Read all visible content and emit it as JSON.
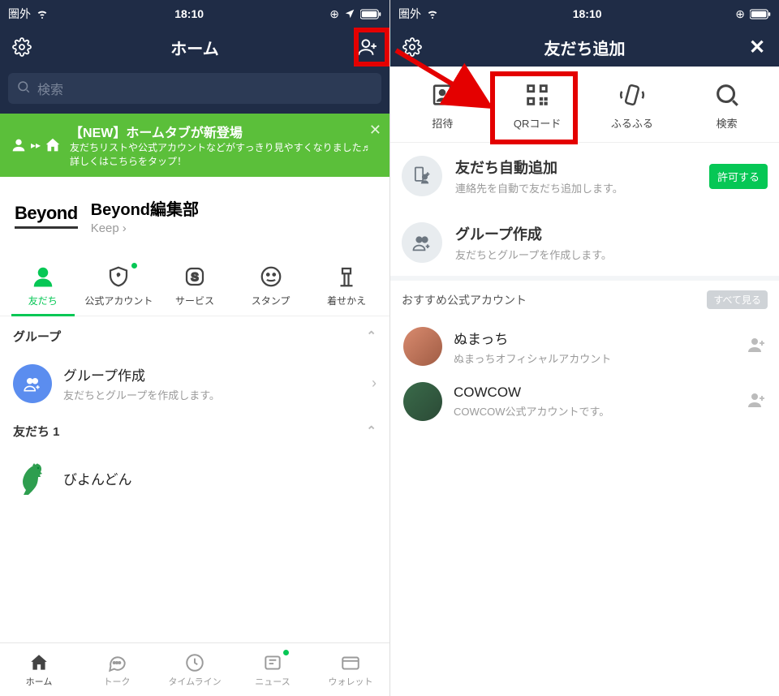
{
  "status": {
    "carrier": "圏外",
    "time": "18:10"
  },
  "left": {
    "title": "ホーム",
    "search_placeholder": "検索",
    "banner": {
      "title": "【NEW】ホームタブが新登場",
      "sub": "友だちリストや公式アカウントなどがすっきり見やすくなりました♬詳しくはこちらをタップ！"
    },
    "profile": {
      "logo": "Beyond",
      "name": "Beyond編集部",
      "keep": "Keep"
    },
    "tabs": {
      "friends": "友だち",
      "official": "公式アカウント",
      "service": "サービス",
      "stamp": "スタンプ",
      "theme": "着せかえ"
    },
    "section_groups": "グループ",
    "group_create": {
      "title": "グループ作成",
      "sub": "友だちとグループを作成します。"
    },
    "section_friends": "友だち 1",
    "friend1": "びよんどん",
    "bottom": {
      "home": "ホーム",
      "talk": "トーク",
      "timeline": "タイムライン",
      "news": "ニュース",
      "wallet": "ウォレット"
    }
  },
  "right": {
    "title": "友だち追加",
    "add": {
      "invite": "招待",
      "qr": "QRコード",
      "shake": "ふるふる",
      "search": "検索"
    },
    "auto": {
      "title": "友だち自動追加",
      "sub": "連絡先を自動で友だち追加します。",
      "btn": "許可する"
    },
    "grp": {
      "title": "グループ作成",
      "sub": "友だちとグループを作成します。"
    },
    "reco_head": "おすすめ公式アカウント",
    "seeall": "すべて見る",
    "acc1": {
      "name": "ぬまっち",
      "sub": "ぬまっちオフィシャルアカウント"
    },
    "acc2": {
      "name": "COWCOW",
      "sub": "COWCOW公式アカウントです。"
    }
  }
}
